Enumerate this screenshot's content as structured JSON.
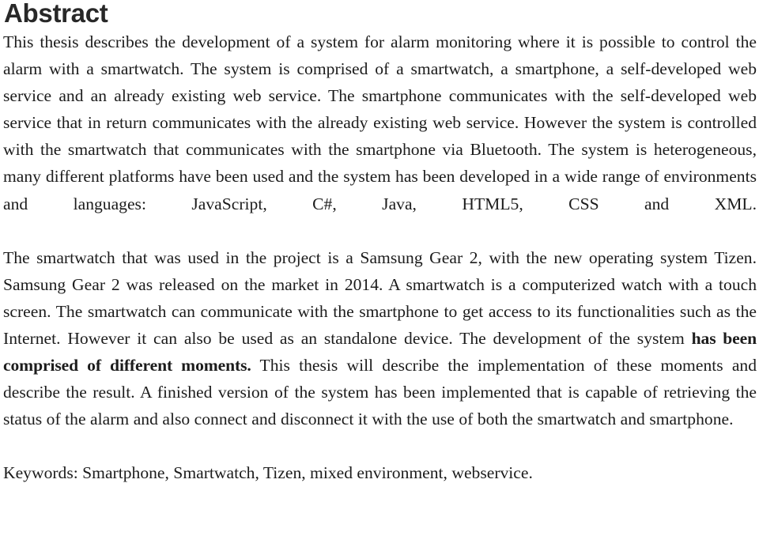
{
  "document": {
    "heading": "Abstract",
    "paragraphs": [
      {
        "id": "p1",
        "text": "This thesis describes the development of a system for alarm monitoring where it is possible to control the alarm with a smartwatch. The system is comprised of a smartwatch, a smartphone, a self-developed web service and an already existing web service. The smartphone communicates with the self-developed web service that in return communicates with the already existing web service. However the system is controlled with the smartwatch that communicates with the smartphone via Bluetooth. The system is heterogeneous, many different platforms have been used and the system has been developed in a wide range of environments and languages: JavaScript, C#, Java, HTML5, CSS and XML."
      },
      {
        "id": "p2",
        "lead": "The smartwatch that was used in the project is a Samsung Gear 2, with the new operating system Tizen. Samsung Gear 2 was released on the market in 2014. A smartwatch is a computerized watch with a touch screen. The smartwatch can communicate with the smartphone to get access to its functionalities such as the Internet. However it can also be used as an standalone device. The development of the system ",
        "emphasis": "has been comprised of different moments.",
        "tail": " This thesis will describe the implementation of these moments and describe the result. A finished version of the system has been implemented that is capable of retrieving the status of the alarm and also connect and disconnect it with the use of both the smartwatch and smartphone."
      }
    ],
    "keywords_line": "Keywords: Smartphone, Smartwatch, Tizen, mixed environment, webservice.",
    "colors": {
      "page_background": "#ffffff",
      "heading_text": "#282828",
      "body_text": "#1c1c1c"
    }
  }
}
